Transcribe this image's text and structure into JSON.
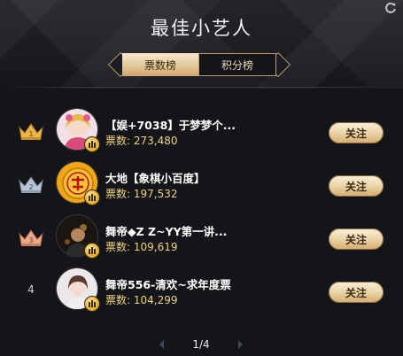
{
  "header": {
    "title": "最佳小艺人",
    "refresh_icon": "refresh-icon"
  },
  "tabs": [
    {
      "label": "票数榜",
      "active": true
    },
    {
      "label": "积分榜",
      "active": false
    }
  ],
  "list": {
    "votes_label": "票数:",
    "follow_label": "关注",
    "items": [
      {
        "rank": "1",
        "name": "【娱+7038】于梦梦个...",
        "votes": "273,480",
        "badge": "gold-crown-icon"
      },
      {
        "rank": "2",
        "name": "大地【象棋小百度】",
        "votes": "197,532",
        "badge": "silver-crown-icon"
      },
      {
        "rank": "3",
        "name": "舞帝◆Z Z~YY第一讲...",
        "votes": "109,619",
        "badge": "bronze-crown-icon"
      },
      {
        "rank": "4",
        "name": "舞帝556-清欢~求年度票",
        "votes": "104,299",
        "badge": ""
      }
    ]
  },
  "pager": {
    "text": "1/4"
  },
  "colors": {
    "gold": "#f0d27a",
    "button_gradient_top": "#fbf0da",
    "button_gradient_bottom": "#d2aa70",
    "background": "#141519"
  }
}
